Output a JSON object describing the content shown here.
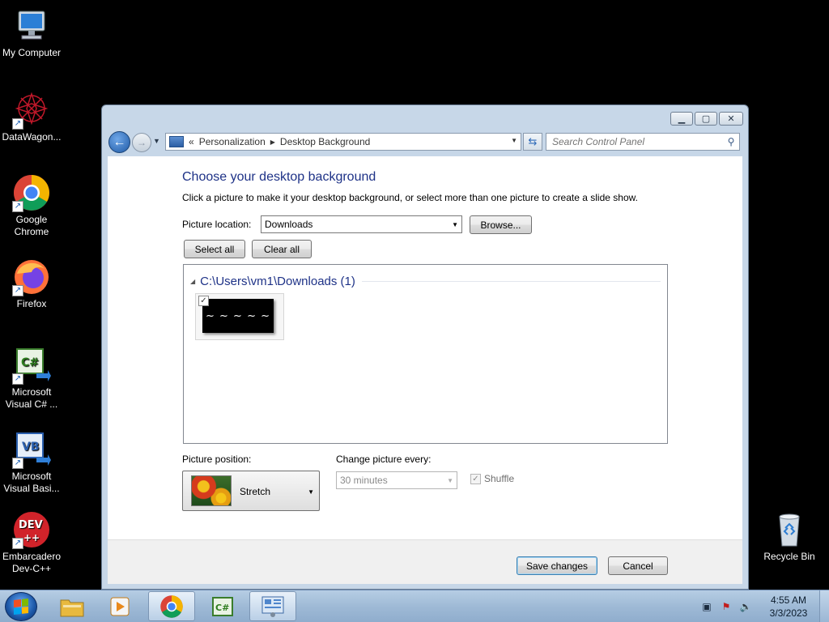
{
  "desktop": {
    "icons": [
      {
        "label": "My Computer"
      },
      {
        "label": "DataWagon..."
      },
      {
        "label": "Google Chrome"
      },
      {
        "label": "Firefox"
      },
      {
        "label": "Microsoft Visual C# ..."
      },
      {
        "label": "Microsoft Visual Basi..."
      },
      {
        "label": "Embarcadero Dev-C++"
      },
      {
        "label": "Recycle Bin"
      }
    ]
  },
  "window": {
    "address": {
      "prefix": "«",
      "segments": [
        "Personalization",
        "Desktop Background"
      ]
    },
    "search": {
      "placeholder": "Search Control Panel"
    },
    "heading": "Choose your desktop background",
    "subtitle": "Click a picture to make it your desktop background, or select more than one picture to create a slide show.",
    "picture_location": {
      "label": "Picture location:",
      "value": "Downloads"
    },
    "browse_label": "Browse...",
    "select_all_label": "Select all",
    "clear_all_label": "Clear all",
    "gallery": {
      "group_label": "C:\\Users\\vm1\\Downloads (1)",
      "items": [
        {
          "checked": true
        }
      ]
    },
    "picture_position": {
      "label": "Picture position:",
      "value": "Stretch"
    },
    "change_every": {
      "label": "Change picture every:",
      "value": "30 minutes",
      "enabled": false
    },
    "shuffle": {
      "label": "Shuffle",
      "checked": true,
      "enabled": false
    },
    "save_label": "Save changes",
    "cancel_label": "Cancel"
  },
  "taskbar": {
    "clock": {
      "time": "4:55 AM",
      "date": "3/3/2023"
    }
  },
  "colors": {
    "heading": "#1e3287",
    "window_frame": "#c7d7e8",
    "taskbar": "#9fbad6"
  }
}
